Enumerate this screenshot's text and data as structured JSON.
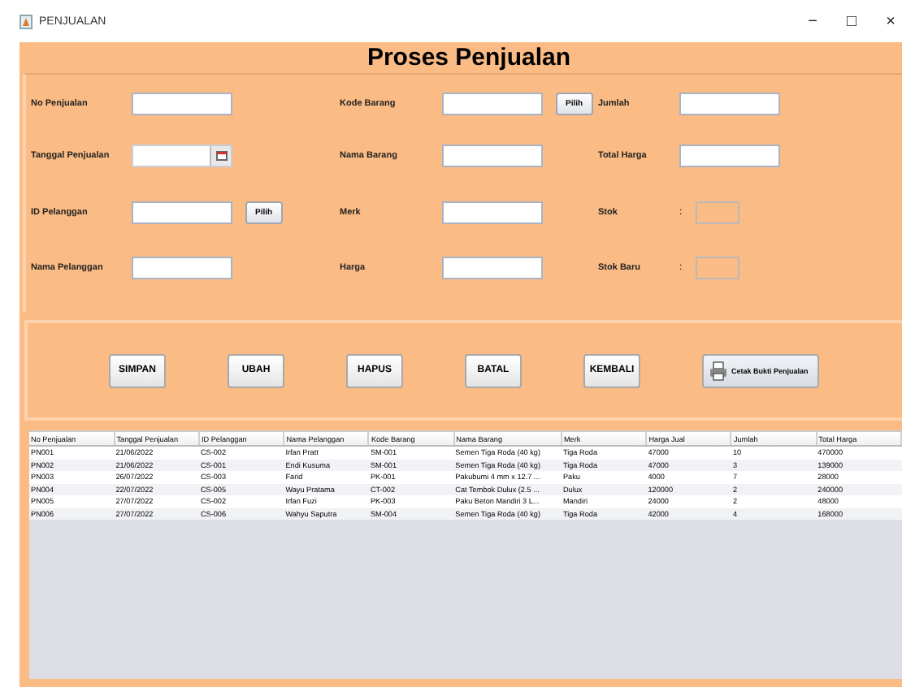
{
  "window": {
    "title": "PENJUALAN",
    "controls": [
      "−",
      "□",
      "×"
    ]
  },
  "heading": "Proses Penjualan",
  "form": {
    "rows": [
      [
        {
          "label": "No Penjualan",
          "kind": "text"
        },
        {
          "label": "Kode Barang",
          "kind": "pick",
          "button": "Pilih"
        },
        {
          "label": "Jumlah",
          "kind": "text"
        }
      ],
      [
        {
          "label": "Tanggal Penjualan",
          "kind": "date"
        },
        {
          "label": "Nama Barang",
          "kind": "text"
        },
        {
          "label": "Total Harga",
          "kind": "text"
        }
      ],
      [
        {
          "label": "ID Pelanggan",
          "kind": "pick",
          "button": "Pilih"
        },
        {
          "label": "Merk",
          "kind": "text"
        },
        {
          "label": "Stok",
          "kind": "stock",
          "separator": ":"
        }
      ],
      [
        {
          "label": "Nama Pelanggan",
          "kind": "text"
        },
        {
          "label": "Harga",
          "kind": "text"
        },
        {
          "label": "Stok Baru",
          "kind": "stock",
          "separator": ":"
        }
      ]
    ]
  },
  "buttons": [
    {
      "label": "SIMPAN",
      "kind": "plain"
    },
    {
      "label": "UBAH",
      "kind": "plain"
    },
    {
      "label": "HAPUS",
      "kind": "plain"
    },
    {
      "label": "BATAL",
      "kind": "plain"
    },
    {
      "label": "KEMBALI",
      "kind": "plain"
    },
    {
      "label": "Cetak Bukti Penjualan",
      "kind": "print"
    }
  ],
  "table": {
    "columns": [
      "No Penjualan",
      "Tanggal Penjualan",
      "ID Pelanggan",
      "Nama Pelanggan",
      "Kode Barang",
      "Nama Barang",
      "Merk",
      "Harga Jual",
      "Jumlah",
      "Total Harga"
    ],
    "rows": [
      [
        "PN001",
        "21/06/2022",
        "CS-002",
        "Irfan Pratt",
        "SM-001",
        "Semen Tiga Roda (40 kg)",
        "Tiga Roda",
        "47000",
        "10",
        "470000"
      ],
      [
        "PN002",
        "21/06/2022",
        "CS-001",
        "Endi Kusuma",
        "SM-001",
        "Semen Tiga Roda (40 kg)",
        "Tiga Roda",
        "47000",
        "3",
        "139000"
      ],
      [
        "PN003",
        "26/07/2022",
        "CS-003",
        "Farid",
        "PK-001",
        "Pakubumi 4 mm x 12.7 ...",
        "Paku",
        "4000",
        "7",
        "28000"
      ],
      [
        "PN004",
        "22/07/2022",
        "CS-005",
        "Wayu Pratama",
        "CT-002",
        "Cat Tembok Dulux (2.5 ...",
        "Dulux",
        "120000",
        "2",
        "240000"
      ],
      [
        "PN005",
        "27/07/2022",
        "CS-002",
        "Irfan Fuzi",
        "PK-003",
        "Paku Beton Mandiri 3 L...",
        "Mandiri",
        "24000",
        "2",
        "48000"
      ],
      [
        "PN006",
        "27/07/2022",
        "CS-006",
        "Wahyu Saputra",
        "SM-004",
        "Semen Tiga Roda (40 kg)",
        "Tiga Roda",
        "42000",
        "4",
        "168000"
      ]
    ]
  }
}
